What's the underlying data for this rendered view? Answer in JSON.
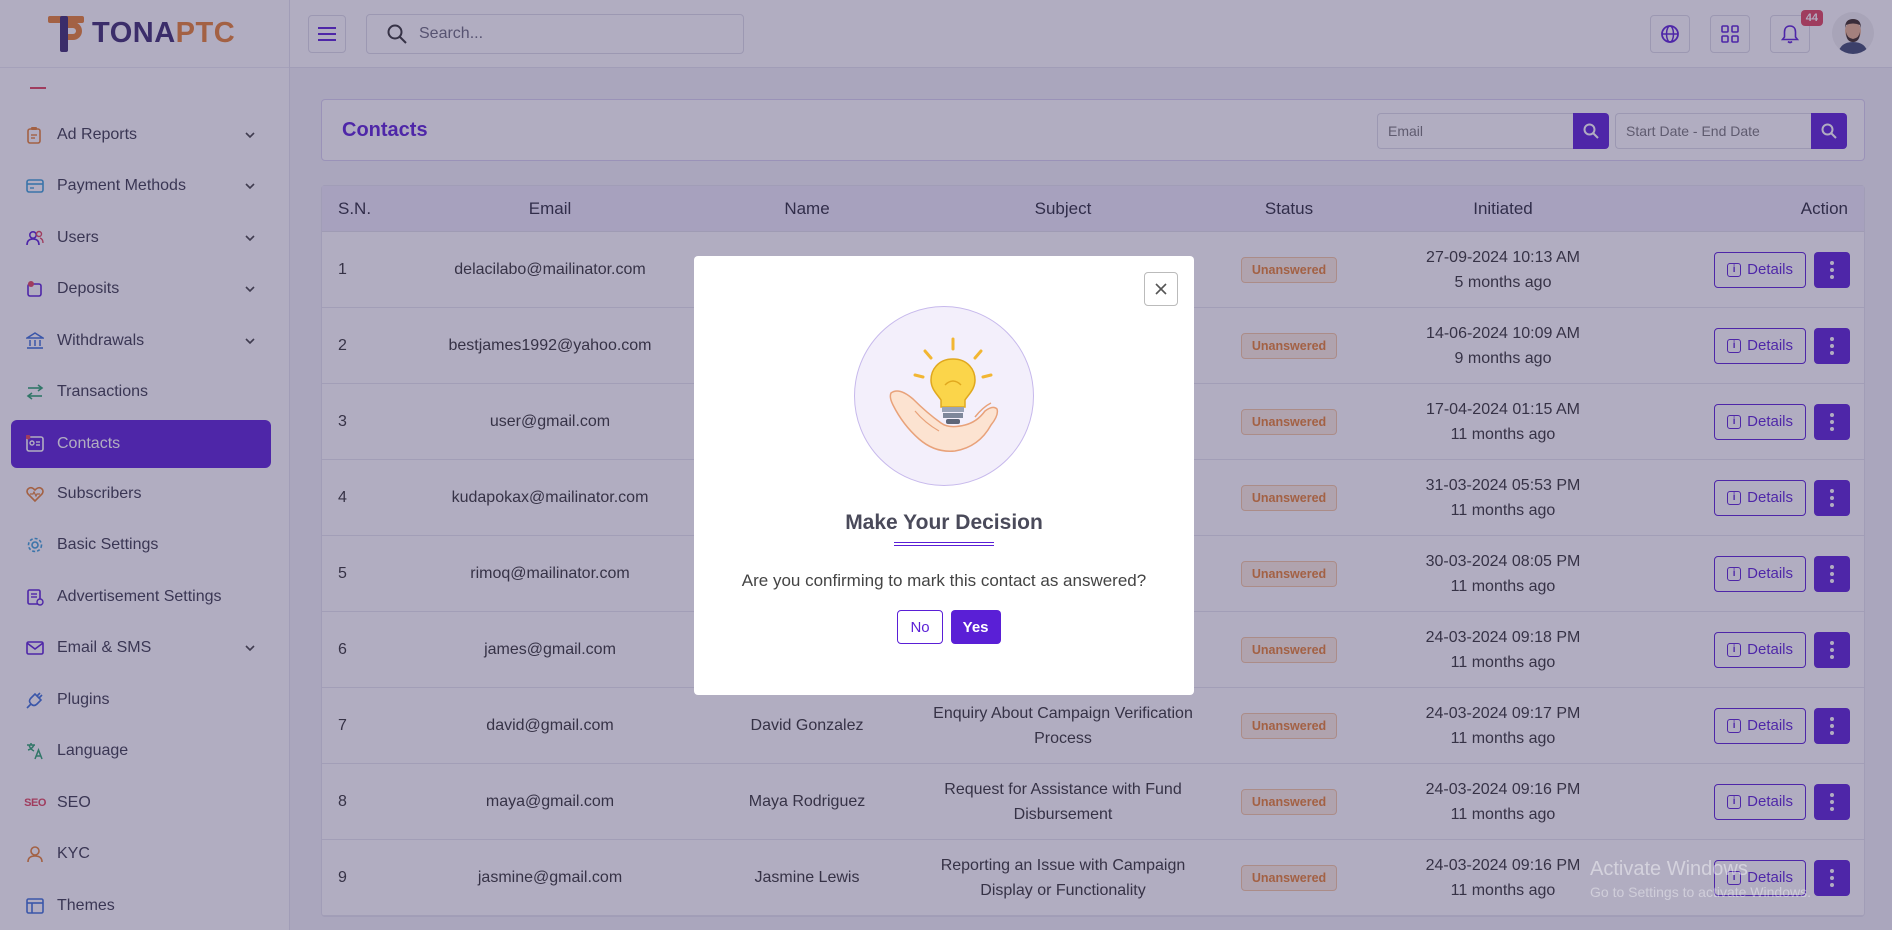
{
  "brand": {
    "part1": "TONA",
    "part2": "PTC"
  },
  "sidebar": {
    "items": [
      {
        "label": "Ad Reports",
        "icon": "ad-reports-icon",
        "color": "#e8812f",
        "chevron": true
      },
      {
        "label": "Payment Methods",
        "icon": "payment-methods-icon",
        "color": "#3aa0d8",
        "chevron": true
      },
      {
        "label": "Users",
        "icon": "users-icon",
        "color": "#5a1fd6",
        "chevron": true
      },
      {
        "label": "Deposits",
        "icon": "deposits-icon",
        "color": "#e2435a",
        "chevron": true
      },
      {
        "label": "Withdrawals",
        "icon": "withdrawals-icon",
        "color": "#3a6fd8",
        "chevron": true
      },
      {
        "label": "Transactions",
        "icon": "transactions-icon",
        "color": "#2aa36b",
        "chevron": false
      },
      {
        "label": "Contacts",
        "icon": "contacts-icon",
        "color": "#ffffff",
        "chevron": false,
        "active": true
      },
      {
        "label": "Subscribers",
        "icon": "subscribers-icon",
        "color": "#e8812f",
        "chevron": false
      },
      {
        "label": "Basic Settings",
        "icon": "gear-icon",
        "color": "#3aa0d8",
        "chevron": false
      },
      {
        "label": "Advertisement Settings",
        "icon": "advertisement-settings-icon",
        "color": "#5a1fd6",
        "chevron": false
      },
      {
        "label": "Email & SMS",
        "icon": "email-icon",
        "color": "#5a1fd6",
        "chevron": true
      },
      {
        "label": "Plugins",
        "icon": "plugins-icon",
        "color": "#3a6fd8",
        "chevron": false
      },
      {
        "label": "Language",
        "icon": "language-icon",
        "color": "#2aa36b",
        "chevron": false
      },
      {
        "label": "SEO",
        "icon": "seo-icon",
        "color": "#e2435a",
        "chevron": false
      },
      {
        "label": "KYC",
        "icon": "kyc-icon",
        "color": "#e8812f",
        "chevron": false
      },
      {
        "label": "Themes",
        "icon": "themes-icon",
        "color": "#3a6fd8",
        "chevron": false
      }
    ]
  },
  "topbar": {
    "search_placeholder": "Search...",
    "notification_count": "44"
  },
  "page": {
    "title": "Contacts",
    "email_placeholder": "Email",
    "date_placeholder": "Start Date - End Date"
  },
  "table": {
    "headers": [
      "S.N.",
      "Email",
      "Name",
      "Subject",
      "Status",
      "Initiated",
      "Action"
    ],
    "details_label": "Details",
    "rows": [
      {
        "sn": "1",
        "email": "delacilabo@mailinator.com",
        "name": "",
        "subject": "",
        "status": "Unanswered",
        "date": "27-09-2024 10:13 AM",
        "ago": "5 months ago"
      },
      {
        "sn": "2",
        "email": "bestjames1992@yahoo.com",
        "name": "",
        "subject": "",
        "status": "Unanswered",
        "date": "14-06-2024 10:09 AM",
        "ago": "9 months ago"
      },
      {
        "sn": "3",
        "email": "user@gmail.com",
        "name": "",
        "subject": "",
        "status": "Unanswered",
        "date": "17-04-2024 01:15 AM",
        "ago": "11 months ago"
      },
      {
        "sn": "4",
        "email": "kudapokax@mailinator.com",
        "name": "",
        "subject": "",
        "status": "Unanswered",
        "date": "31-03-2024 05:53 PM",
        "ago": "11 months ago"
      },
      {
        "sn": "5",
        "email": "rimoq@mailinator.com",
        "name": "",
        "subject": "",
        "status": "Unanswered",
        "date": "30-03-2024 08:05 PM",
        "ago": "11 months ago"
      },
      {
        "sn": "6",
        "email": "james@gmail.com",
        "name": "",
        "subject": "",
        "status": "Unanswered",
        "date": "24-03-2024 09:18 PM",
        "ago": "11 months ago"
      },
      {
        "sn": "7",
        "email": "david@gmail.com",
        "name": "David Gonzalez",
        "subject": "Enquiry About Campaign Verification Process",
        "status": "Unanswered",
        "date": "24-03-2024 09:17 PM",
        "ago": "11 months ago"
      },
      {
        "sn": "8",
        "email": "maya@gmail.com",
        "name": "Maya Rodriguez",
        "subject": "Request for Assistance with Fund Disbursement",
        "status": "Unanswered",
        "date": "24-03-2024 09:16 PM",
        "ago": "11 months ago"
      },
      {
        "sn": "9",
        "email": "jasmine@gmail.com",
        "name": "Jasmine Lewis",
        "subject": "Reporting an Issue with Campaign Display or Functionality",
        "status": "Unanswered",
        "date": "24-03-2024 09:16 PM",
        "ago": "11 months ago"
      }
    ]
  },
  "modal": {
    "title": "Make Your Decision",
    "message": "Are you confirming to mark this contact as answered?",
    "no_label": "No",
    "yes_label": "Yes"
  },
  "watermark": {
    "line1": "Activate Windows",
    "line2": "Go to Settings to activate Windows."
  },
  "colors": {
    "accent": "#5a1fd6",
    "brand_orange": "#e8812f",
    "status_text": "#e8812f"
  }
}
